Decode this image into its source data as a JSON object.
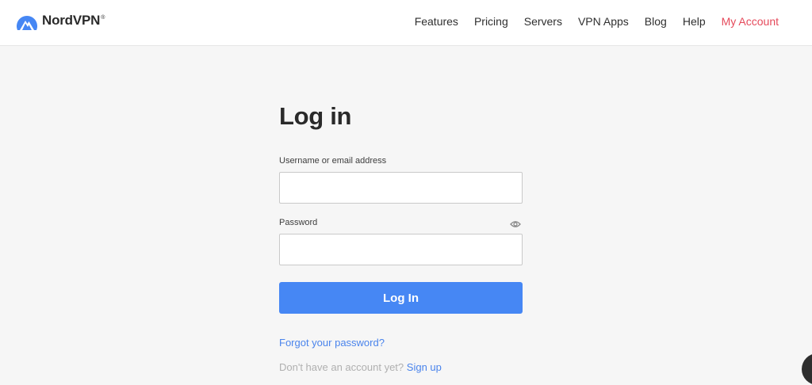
{
  "brand": {
    "name": "NordVPN",
    "reg": "®",
    "accent": "#4687f4"
  },
  "nav": {
    "items": [
      {
        "label": "Features"
      },
      {
        "label": "Pricing"
      },
      {
        "label": "Servers"
      },
      {
        "label": "VPN Apps"
      },
      {
        "label": "Blog"
      },
      {
        "label": "Help"
      }
    ],
    "account": {
      "label": "My Account",
      "color": "#e54a5b"
    }
  },
  "login": {
    "title": "Log in",
    "username_label": "Username or email address",
    "username_value": "",
    "password_label": "Password",
    "password_value": "",
    "show_password_icon": "eye-icon",
    "submit_label": "Log In",
    "forgot_label": "Forgot your password?",
    "signup_prompt": "Don't have an account yet?",
    "signup_label": "Sign up"
  }
}
